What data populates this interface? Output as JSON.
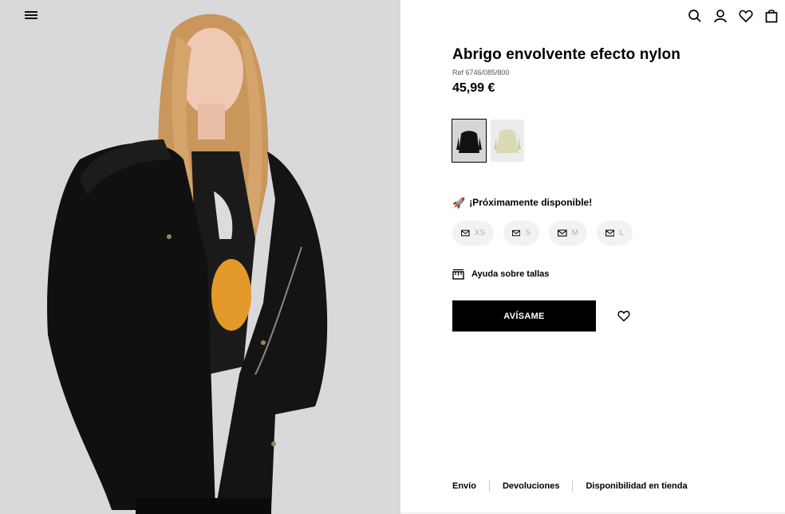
{
  "header": {
    "menu_icon": "hamburger-menu-icon",
    "icons": [
      "search-icon",
      "user-icon",
      "heart-icon",
      "bag-icon"
    ]
  },
  "product": {
    "title": "Abrigo envolvente efecto nylon",
    "ref": "Ref 6746/085/800",
    "price": "45,99 €",
    "colors": [
      {
        "name": "black",
        "hex": "#111111",
        "selected": true
      },
      {
        "name": "beige",
        "hex": "#dcd9b5",
        "selected": false
      }
    ],
    "availability": {
      "icon": "rocket-icon",
      "emoji": "🚀",
      "text": "¡Próximamente disponible!"
    },
    "sizes": [
      {
        "label": "XS",
        "icon": "mail-icon"
      },
      {
        "label": "S",
        "icon": "mail-icon"
      },
      {
        "label": "M",
        "icon": "mail-icon"
      },
      {
        "label": "L",
        "icon": "mail-icon"
      }
    ],
    "size_help": "Ayuda sobre tallas",
    "notify_button": "AVÍSAME",
    "wishlist_icon": "heart-icon"
  },
  "footer": {
    "links": [
      "Envío",
      "Devoluciones",
      "Disponibilidad en tienda"
    ]
  },
  "colors": {
    "photo_bg": "#d9d9db",
    "button_bg": "#000000",
    "size_pill_bg": "#f2f2f2",
    "size_text": "#b4b4b4"
  }
}
